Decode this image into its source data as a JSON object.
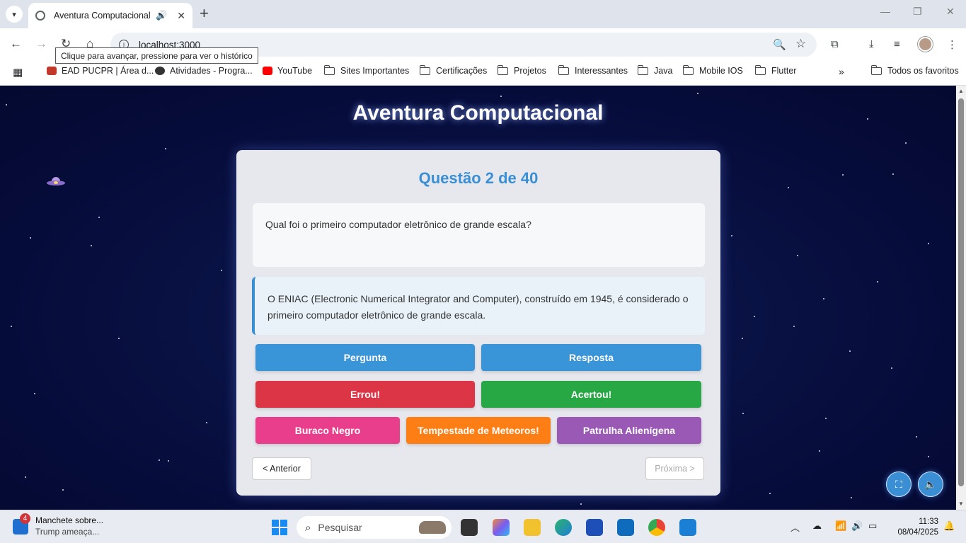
{
  "browser": {
    "tab_title": "Aventura Computacional",
    "url": "localhost:3000",
    "tooltip": "Clique para avançar, pressione para ver o histórico",
    "bookmarks": [
      {
        "label": "EAD PUCPR | Área d..."
      },
      {
        "label": "Atividades - Progra..."
      },
      {
        "label": "YouTube"
      },
      {
        "label": "Sites Importantes"
      },
      {
        "label": "Certificações"
      },
      {
        "label": "Projetos"
      },
      {
        "label": "Interessantes"
      },
      {
        "label": "Java"
      },
      {
        "label": "Mobile IOS"
      },
      {
        "label": "Flutter"
      }
    ],
    "all_bookmarks": "Todos os favoritos"
  },
  "app": {
    "title": "Aventura Computacional",
    "question_heading": "Questão 2 de 40",
    "question": "Qual foi o primeiro computador eletrônico de grande escala?",
    "answer": "O ENIAC (Electronic Numerical Integrator and Computer), construído em 1945, é considerado o primeiro computador eletrônico de grande escala.",
    "buttons": {
      "pergunta": "Pergunta",
      "resposta": "Resposta",
      "errou": "Errou!",
      "acertou": "Acertou!",
      "buraco_negro": "Buraco Negro",
      "tempestade": "Tempestade de Meteoros!",
      "patrulha": "Patrulha Alienígena"
    },
    "nav": {
      "prev": "< Anterior",
      "next": "Próxima >"
    }
  },
  "taskbar": {
    "news_badge": "4",
    "news_title": "Manchete sobre...",
    "news_sub": "Trump ameaça...",
    "search_placeholder": "Pesquisar",
    "time": "11:33",
    "date": "08/04/2025"
  },
  "colors": {
    "accent": "#3a8fd4",
    "red": "#dc3545",
    "green": "#28a745",
    "pink": "#e83e8c",
    "orange": "#fd7e14",
    "purple": "#9b59b6"
  }
}
